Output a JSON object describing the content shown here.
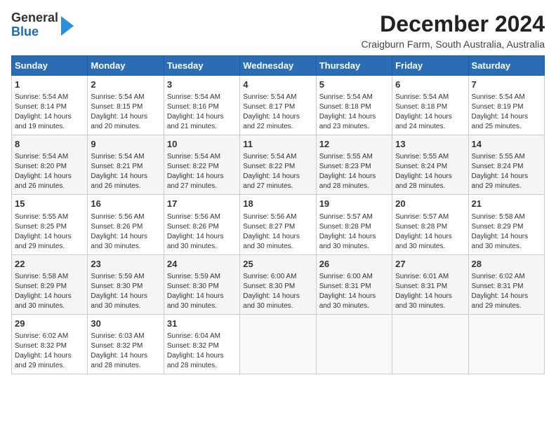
{
  "header": {
    "logo_general": "General",
    "logo_blue": "Blue",
    "title": "December 2024",
    "location": "Craigburn Farm, South Australia, Australia"
  },
  "calendar": {
    "days_of_week": [
      "Sunday",
      "Monday",
      "Tuesday",
      "Wednesday",
      "Thursday",
      "Friday",
      "Saturday"
    ],
    "weeks": [
      [
        {
          "day": "",
          "info": ""
        },
        {
          "day": "2",
          "info": "Sunrise: 5:54 AM\nSunset: 8:15 PM\nDaylight: 14 hours\nand 20 minutes."
        },
        {
          "day": "3",
          "info": "Sunrise: 5:54 AM\nSunset: 8:16 PM\nDaylight: 14 hours\nand 21 minutes."
        },
        {
          "day": "4",
          "info": "Sunrise: 5:54 AM\nSunset: 8:17 PM\nDaylight: 14 hours\nand 22 minutes."
        },
        {
          "day": "5",
          "info": "Sunrise: 5:54 AM\nSunset: 8:18 PM\nDaylight: 14 hours\nand 23 minutes."
        },
        {
          "day": "6",
          "info": "Sunrise: 5:54 AM\nSunset: 8:18 PM\nDaylight: 14 hours\nand 24 minutes."
        },
        {
          "day": "7",
          "info": "Sunrise: 5:54 AM\nSunset: 8:19 PM\nDaylight: 14 hours\nand 25 minutes."
        }
      ],
      [
        {
          "day": "1",
          "info": "Sunrise: 5:54 AM\nSunset: 8:14 PM\nDaylight: 14 hours\nand 19 minutes."
        },
        {
          "day": "",
          "info": ""
        },
        {
          "day": "",
          "info": ""
        },
        {
          "day": "",
          "info": ""
        },
        {
          "day": "",
          "info": ""
        },
        {
          "day": "",
          "info": ""
        },
        {
          "day": "",
          "info": ""
        }
      ],
      [
        {
          "day": "8",
          "info": "Sunrise: 5:54 AM\nSunset: 8:20 PM\nDaylight: 14 hours\nand 26 minutes."
        },
        {
          "day": "9",
          "info": "Sunrise: 5:54 AM\nSunset: 8:21 PM\nDaylight: 14 hours\nand 26 minutes."
        },
        {
          "day": "10",
          "info": "Sunrise: 5:54 AM\nSunset: 8:22 PM\nDaylight: 14 hours\nand 27 minutes."
        },
        {
          "day": "11",
          "info": "Sunrise: 5:54 AM\nSunset: 8:22 PM\nDaylight: 14 hours\nand 27 minutes."
        },
        {
          "day": "12",
          "info": "Sunrise: 5:55 AM\nSunset: 8:23 PM\nDaylight: 14 hours\nand 28 minutes."
        },
        {
          "day": "13",
          "info": "Sunrise: 5:55 AM\nSunset: 8:24 PM\nDaylight: 14 hours\nand 28 minutes."
        },
        {
          "day": "14",
          "info": "Sunrise: 5:55 AM\nSunset: 8:24 PM\nDaylight: 14 hours\nand 29 minutes."
        }
      ],
      [
        {
          "day": "15",
          "info": "Sunrise: 5:55 AM\nSunset: 8:25 PM\nDaylight: 14 hours\nand 29 minutes."
        },
        {
          "day": "16",
          "info": "Sunrise: 5:56 AM\nSunset: 8:26 PM\nDaylight: 14 hours\nand 30 minutes."
        },
        {
          "day": "17",
          "info": "Sunrise: 5:56 AM\nSunset: 8:26 PM\nDaylight: 14 hours\nand 30 minutes."
        },
        {
          "day": "18",
          "info": "Sunrise: 5:56 AM\nSunset: 8:27 PM\nDaylight: 14 hours\nand 30 minutes."
        },
        {
          "day": "19",
          "info": "Sunrise: 5:57 AM\nSunset: 8:28 PM\nDaylight: 14 hours\nand 30 minutes."
        },
        {
          "day": "20",
          "info": "Sunrise: 5:57 AM\nSunset: 8:28 PM\nDaylight: 14 hours\nand 30 minutes."
        },
        {
          "day": "21",
          "info": "Sunrise: 5:58 AM\nSunset: 8:29 PM\nDaylight: 14 hours\nand 30 minutes."
        }
      ],
      [
        {
          "day": "22",
          "info": "Sunrise: 5:58 AM\nSunset: 8:29 PM\nDaylight: 14 hours\nand 30 minutes."
        },
        {
          "day": "23",
          "info": "Sunrise: 5:59 AM\nSunset: 8:30 PM\nDaylight: 14 hours\nand 30 minutes."
        },
        {
          "day": "24",
          "info": "Sunrise: 5:59 AM\nSunset: 8:30 PM\nDaylight: 14 hours\nand 30 minutes."
        },
        {
          "day": "25",
          "info": "Sunrise: 6:00 AM\nSunset: 8:30 PM\nDaylight: 14 hours\nand 30 minutes."
        },
        {
          "day": "26",
          "info": "Sunrise: 6:00 AM\nSunset: 8:31 PM\nDaylight: 14 hours\nand 30 minutes."
        },
        {
          "day": "27",
          "info": "Sunrise: 6:01 AM\nSunset: 8:31 PM\nDaylight: 14 hours\nand 30 minutes."
        },
        {
          "day": "28",
          "info": "Sunrise: 6:02 AM\nSunset: 8:31 PM\nDaylight: 14 hours\nand 29 minutes."
        }
      ],
      [
        {
          "day": "29",
          "info": "Sunrise: 6:02 AM\nSunset: 8:32 PM\nDaylight: 14 hours\nand 29 minutes."
        },
        {
          "day": "30",
          "info": "Sunrise: 6:03 AM\nSunset: 8:32 PM\nDaylight: 14 hours\nand 28 minutes."
        },
        {
          "day": "31",
          "info": "Sunrise: 6:04 AM\nSunset: 8:32 PM\nDaylight: 14 hours\nand 28 minutes."
        },
        {
          "day": "",
          "info": ""
        },
        {
          "day": "",
          "info": ""
        },
        {
          "day": "",
          "info": ""
        },
        {
          "day": "",
          "info": ""
        }
      ]
    ]
  }
}
